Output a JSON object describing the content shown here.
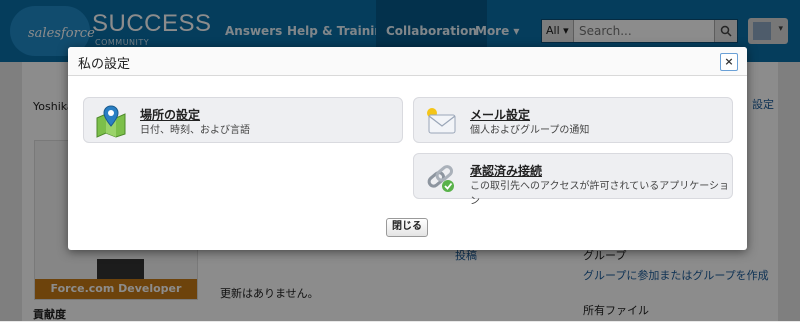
{
  "header": {
    "logo_text": "salesforce",
    "brand": "SUCCESS",
    "brand_sub": "COMMUNITY",
    "nav": [
      "Answers",
      "Help & Training",
      "Collaboration",
      "More ▾"
    ],
    "search_scope": "All ▾",
    "search_placeholder": "Search..."
  },
  "background": {
    "user_name": "Yoshika",
    "right_link_fragment": "設定",
    "profile_label": "Force.com Developer",
    "contribution": "貢献度",
    "no_updates": "更新はありません。",
    "groups_fragment": "グループ",
    "group_link": "グループに参加またはグループを作成",
    "files_heading": "所有ファイル",
    "small_link": "投稿"
  },
  "dialog": {
    "title": "私の設定",
    "close_x": "×",
    "items": [
      {
        "icon": "map-pin-icon",
        "title": "場所の設定",
        "desc": "日付、時刻、および言語"
      },
      {
        "icon": "envelope-icon",
        "title": "メール設定",
        "desc": "個人およびグループの通知"
      },
      {
        "icon": "chain-link-icon",
        "title": "承認済み接続",
        "desc": "この取引先へのアクセスが許可されているアプリケーション"
      }
    ],
    "close_button": "閉じる"
  }
}
